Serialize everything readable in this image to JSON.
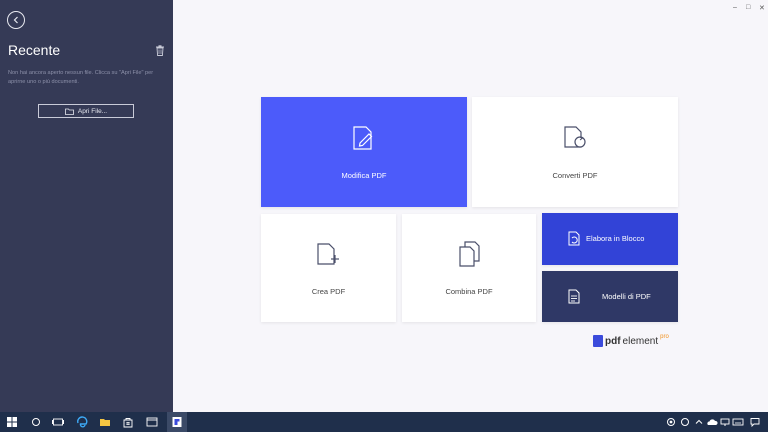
{
  "sidebar": {
    "title": "Recente",
    "empty_message": "Non hai ancora aperto nessun file. Clicca su \"Apri File\" per aprirne uno o più documenti.",
    "open_button": "Apri File..."
  },
  "tiles": {
    "edit": "Modifica PDF",
    "convert": "Converti PDF",
    "create": "Crea PDF",
    "combine": "Combina PDF",
    "batch": "Elabora in Blocco",
    "templates": "Modelli di PDF"
  },
  "logo": {
    "pdf": "pdf",
    "element": "element",
    "pro": "pro"
  },
  "window_controls": {
    "minimize": "–",
    "maximize": "□",
    "close": "✕"
  },
  "colors": {
    "sidebar": "#353a56",
    "edit_tile": "#4c5bfa",
    "batch_tile": "#3243d7",
    "template_tile": "#2f3866",
    "taskbar": "#1f2f4b"
  }
}
